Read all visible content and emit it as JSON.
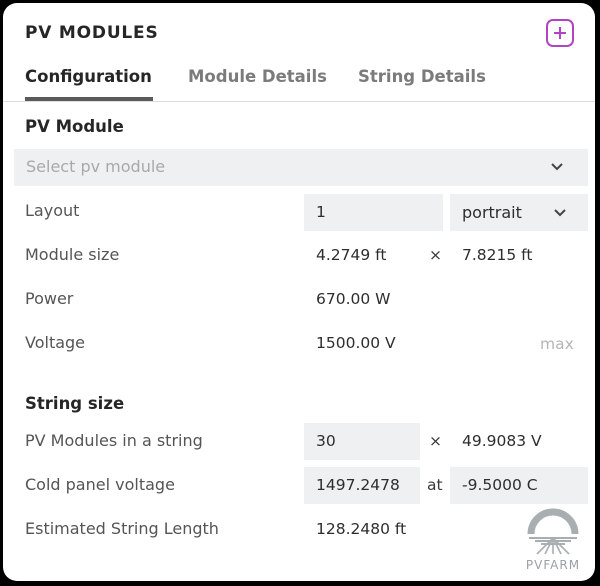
{
  "header": {
    "title": "PV MODULES",
    "collapse_icon": "collapse-icon"
  },
  "tabs": [
    {
      "label": "Configuration",
      "active": true
    },
    {
      "label": "Module Details",
      "active": false
    },
    {
      "label": "String Details",
      "active": false
    }
  ],
  "pv_module": {
    "section_title": "PV Module",
    "select_placeholder": "Select pv module",
    "layout": {
      "label": "Layout",
      "count": "1",
      "orientation": "portrait"
    },
    "module_size": {
      "label": "Module size",
      "width": "4.2749 ft",
      "separator": "×",
      "height": "7.8215 ft"
    },
    "power": {
      "label": "Power",
      "value": "670.00 W"
    },
    "voltage": {
      "label": "Voltage",
      "value": "1500.00 V",
      "suffix": "max"
    }
  },
  "string_size": {
    "section_title": "String size",
    "modules_in_string": {
      "label": "PV Modules in a string",
      "value": "30",
      "separator": "×",
      "string_voltage": "49.9083 V"
    },
    "cold_panel_voltage": {
      "label": "Cold panel voltage",
      "value": "1497.2478",
      "at_label": "at",
      "temperature": "-9.5000 C"
    },
    "estimated_length": {
      "label": "Estimated String Length",
      "value": "128.2480 ft"
    }
  },
  "logo": {
    "text": "PVFARM"
  },
  "colors": {
    "accent": "#b144c2",
    "field_bg": "#eef0f1",
    "tab_underline": "#5a5a5a"
  }
}
